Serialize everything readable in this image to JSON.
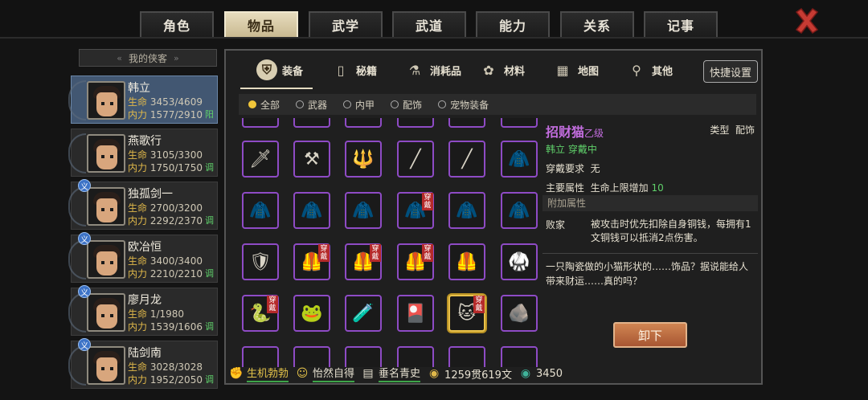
{
  "top_tabs": [
    "角色",
    "物品",
    "武学",
    "武道",
    "能力",
    "关系",
    "记事"
  ],
  "active_top_tab": "物品",
  "left_panel": {
    "header": "我的侠客",
    "characters": [
      {
        "name": "韩立",
        "hp_label": "生命",
        "hp": "3453/4609",
        "mp_label": "内力",
        "mp": "1577/2910",
        "state": "阳",
        "active": true
      },
      {
        "name": "燕歌行",
        "hp_label": "生命",
        "hp": "3105/3300",
        "mp_label": "内力",
        "mp": "1750/1750",
        "state": "调"
      },
      {
        "name": "独孤剑一",
        "hp_label": "生命",
        "hp": "2700/3200",
        "mp_label": "内力",
        "mp": "2292/2370",
        "state": "调",
        "badge": "义"
      },
      {
        "name": "欧冶恒",
        "hp_label": "生命",
        "hp": "3400/3400",
        "mp_label": "内力",
        "mp": "2210/2210",
        "state": "调",
        "badge": "义"
      },
      {
        "name": "廖月龙",
        "hp_label": "生命",
        "hp": "1/1980",
        "mp_label": "内力",
        "mp": "1539/1606",
        "state": "调",
        "badge": "义"
      },
      {
        "name": "陆剑南",
        "hp_label": "生命",
        "hp": "3028/3028",
        "mp_label": "内力",
        "mp": "1952/2050",
        "state": "调",
        "badge": "义"
      }
    ]
  },
  "category_tabs": [
    {
      "label": "装备",
      "icon": "armor-icon",
      "active": true
    },
    {
      "label": "秘籍",
      "icon": "book-icon"
    },
    {
      "label": "消耗品",
      "icon": "potion-icon"
    },
    {
      "label": "材料",
      "icon": "material-icon"
    },
    {
      "label": "地图",
      "icon": "map-icon"
    },
    {
      "label": "其他",
      "icon": "other-icon"
    }
  ],
  "quick_settings": "快捷设置",
  "filters": [
    {
      "label": "全部",
      "on": true
    },
    {
      "label": "武器"
    },
    {
      "label": "内甲"
    },
    {
      "label": "配饰"
    },
    {
      "label": "宠物装备"
    }
  ],
  "wear_tag": "穿戴",
  "items": [
    {
      "icon": "dagger-icon",
      "glyph": "🗡",
      "worn": false
    },
    {
      "icon": "spear-icon",
      "glyph": "⚒",
      "worn": false
    },
    {
      "icon": "blue-spear-icon",
      "glyph": "🔱",
      "worn": false
    },
    {
      "icon": "staff-icon",
      "glyph": "╱",
      "worn": false
    },
    {
      "icon": "staff-icon",
      "glyph": "╱",
      "worn": false
    },
    {
      "icon": "gold-robe-icon",
      "glyph": "🧥",
      "worn": false
    },
    {
      "icon": "gold-robe-icon",
      "glyph": "🧥",
      "worn": false
    },
    {
      "icon": "gold-robe-icon",
      "glyph": "🧥",
      "worn": false
    },
    {
      "icon": "gold-robe-icon",
      "glyph": "🧥",
      "worn": false
    },
    {
      "icon": "gold-robe-icon",
      "glyph": "🧥",
      "worn": true
    },
    {
      "icon": "gold-robe-icon",
      "glyph": "🧥",
      "worn": false
    },
    {
      "icon": "gold-robe-icon",
      "glyph": "🧥",
      "worn": false
    },
    {
      "icon": "silver-armor-icon",
      "glyph": "🛡",
      "worn": false
    },
    {
      "icon": "scale-armor-icon",
      "glyph": "🦺",
      "worn": true
    },
    {
      "icon": "scale-armor-icon",
      "glyph": "🦺",
      "worn": true
    },
    {
      "icon": "scale-armor-icon",
      "glyph": "🦺",
      "worn": true
    },
    {
      "icon": "scale-armor-icon",
      "glyph": "🦺",
      "worn": false
    },
    {
      "icon": "leather-armor-icon",
      "glyph": "🥋",
      "worn": false
    },
    {
      "icon": "blue-charm-icon",
      "glyph": "🐍",
      "worn": true
    },
    {
      "icon": "gold-charm-icon",
      "glyph": "🐸",
      "worn": false
    },
    {
      "icon": "jade-tube-icon",
      "glyph": "🧪",
      "worn": false
    },
    {
      "icon": "gold-card-icon",
      "glyph": "🎴",
      "worn": false
    },
    {
      "icon": "lucky-cat-icon",
      "glyph": "🐱",
      "worn": true,
      "selected": true
    },
    {
      "icon": "gray-stone-icon",
      "glyph": "🪨",
      "worn": false
    }
  ],
  "detail": {
    "name": "招财猫",
    "grade": "乙级",
    "type_label": "类型",
    "type_value": "配饰",
    "owner_status": "韩立 穿戴中",
    "req_label": "穿戴要求",
    "req_value": "无",
    "main_attr_label": "主要属性",
    "main_attr_text": "生命上限增加",
    "main_attr_value": "10",
    "extra_attr_header": "附加属性",
    "effect_name": "败家",
    "effect_text": "被攻击时优先扣除自身铜钱，每拥有1文铜钱可以抵消2点伤害。",
    "description": "一只陶瓷做的小猫形状的……饰品？据说能给人带来财运……真的吗？",
    "unequip_button": "卸下"
  },
  "bottom": {
    "status1": "生机勃勃",
    "status2": "怡然自得",
    "status3": "垂名青史",
    "money": "1259贯619文",
    "jade": "3450"
  }
}
